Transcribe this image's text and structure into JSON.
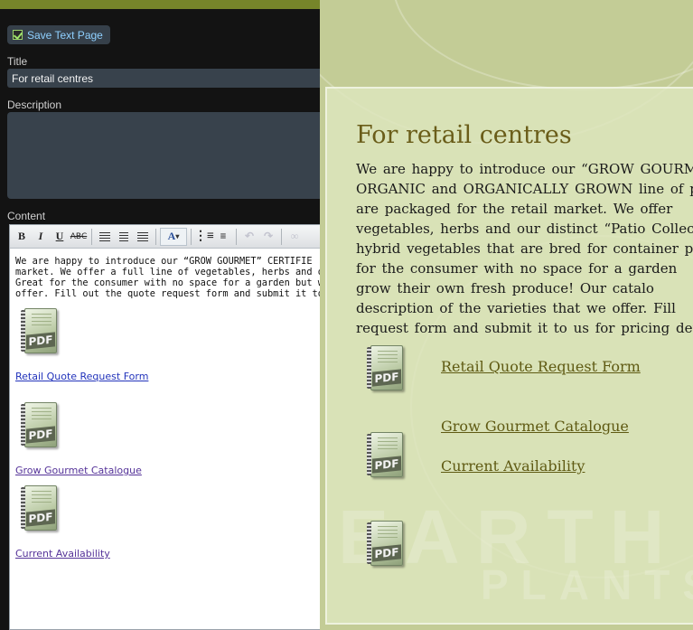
{
  "editor": {
    "save_label": "Save Text Page",
    "title_label": "Title",
    "title_value": "For retail centres",
    "description_label": "Description",
    "description_value": "",
    "content_label": "Content",
    "content_lines": [
      "We are happy to introduce our “GROW GOURMET” CERTIFIE",
      "market.  We offer a full line of vegetables, herbs and our di",
      "Great for the consumer with no space for a garden but wanti",
      "offer.  Fill out the quote request form and submit it to us for"
    ],
    "files": [
      {
        "label": "Retail Quote Request Form",
        "icon": "pdf-icon"
      },
      {
        "label": "Grow Gourmet Catalogue",
        "icon": "pdf-icon"
      },
      {
        "label": "Current Availability",
        "icon": "pdf-icon"
      }
    ],
    "pdf_tag": "PDF"
  },
  "preview": {
    "heading": "For retail centres",
    "body_lines": [
      "We are happy to introduce our “GROW GOURM",
      "ORGANIC and ORGANICALLY GROWN line of plan",
      "are packaged for the retail market.  We offer",
      "vegetables, herbs and our distinct “Patio Collecti",
      "hybrid vegetables that are bred for container pro",
      "for the consumer with no space for a garden",
      "grow their own fresh produce!  Our catalo",
      "description of the varieties that we offer.  Fill",
      "request form and submit it to us for pricing details"
    ],
    "links": {
      "quote": "Retail Quote Request Form",
      "catalogue": "Grow Gourmet Catalogue",
      "availability": "Current Availability"
    },
    "watermark_top": "EARTH",
    "watermark_bottom": "PLANTS",
    "pdf_tag": "PDF"
  },
  "colors": {
    "accent_bar": "#76852a",
    "save_text": "#8fd0ff",
    "heading": "#6a5d19",
    "link": "#5f5a13"
  }
}
